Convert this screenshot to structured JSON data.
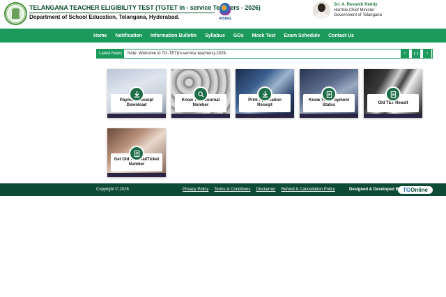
{
  "header": {
    "title": "TELANGANA TEACHER ELIGIBILITY TEST (TGTET In - service Teachers - 2026)",
    "subtitle": "Department of School Education, Telangana, Hyderabad.",
    "rising_word": "RISING",
    "cm_name": "Sri. A. Revanth Reddy",
    "cm_role": "Hon'ble Chief Minister",
    "cm_govt": "Government of Telangana"
  },
  "nav": {
    "items": [
      "Home",
      "Notification",
      "Information Bulletin",
      "Syllabus",
      "GOs",
      "Mock Test",
      "Exam Schedule",
      "Contact Us"
    ]
  },
  "news": {
    "label": "Latest News",
    "text": "Note: Welcome to TG-TET(In-service teachers)-2026.",
    "prev_icon": "‹",
    "pause_icon": "❙❙",
    "next_icon": "›"
  },
  "cards": [
    {
      "label": "Payment Receipt Download",
      "icon": "download-icon"
    },
    {
      "label": "Know Your Journal Number",
      "icon": "search-document-icon"
    },
    {
      "label": "Print Application Receipt",
      "icon": "download-icon"
    },
    {
      "label": "Know Your Payment Status",
      "icon": "receipt-icon"
    },
    {
      "label": "Old TET Result",
      "icon": "document-icon"
    },
    {
      "label": "Get Old TET HallTicket Number",
      "icon": "document-icon"
    }
  ],
  "footer": {
    "copyright": "Copyright © 2026",
    "links": [
      "Privacy Policy",
      "Terms & Conditions",
      "Disclaimer",
      "Refund & Cancellation Policy"
    ],
    "designed_by": "Designed & Developed By",
    "brand_tg": "TG",
    "brand_online": "Online"
  },
  "colors": {
    "primary_green": "#1b9a5c",
    "footer_green": "#0d4a35",
    "title_green": "#0a4d2c",
    "icon_green": "#1f6d48"
  }
}
